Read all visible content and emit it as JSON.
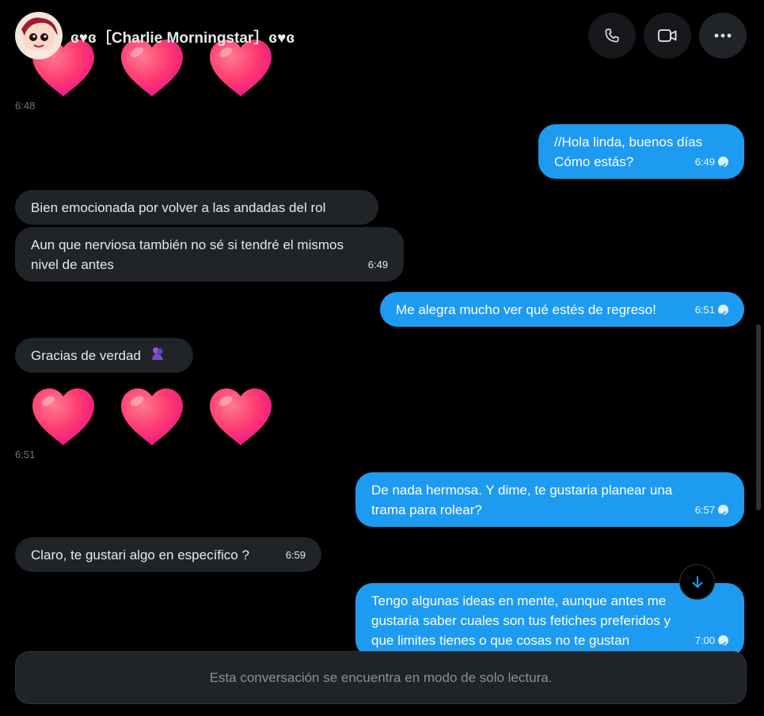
{
  "header": {
    "contact_name": "ɞ♥ɞ［Charlie Morningstar］ɞ♥ɞ",
    "call_icon": "phone-icon",
    "video_icon": "video-camera-icon",
    "more_icon": "more-horizontal-icon"
  },
  "colors": {
    "background": "#000000",
    "incoming_bubble": "#202327",
    "outgoing_bubble": "#1d9bf0",
    "heart": "#ff3b70"
  },
  "messages": [
    {
      "id": "m1",
      "direction": "in",
      "kind": "hearts",
      "count": 3,
      "time": "6:48"
    },
    {
      "id": "m2",
      "direction": "out",
      "lines": [
        "//Hola linda, buenos días",
        "Cómo estás?"
      ],
      "time": "6:49"
    },
    {
      "id": "m3",
      "direction": "in",
      "lines": [
        "Bien emocionada por volver a las andadas del rol"
      ],
      "time": ""
    },
    {
      "id": "m4",
      "direction": "in",
      "lines": [
        "Aun que nerviosa también no sé si tendré el mismos",
        "nivel de antes"
      ],
      "time": "6:49"
    },
    {
      "id": "m5",
      "direction": "out",
      "lines": [
        "Me alegra mucho ver qué estés de regreso!"
      ],
      "time": "6:51"
    },
    {
      "id": "m6",
      "direction": "in",
      "lines": [
        "Gracias de verdad"
      ],
      "emoji": "🫂",
      "time": ""
    },
    {
      "id": "m7",
      "direction": "in",
      "kind": "hearts",
      "count": 3,
      "time": "6:51"
    },
    {
      "id": "m8",
      "direction": "out",
      "lines": [
        "De nada hermosa. Y dime, te gustaria planear una",
        "trama para rolear?"
      ],
      "time": "6:57"
    },
    {
      "id": "m9",
      "direction": "in",
      "lines": [
        "Claro, te gustari algo en específico ?"
      ],
      "time": "6:59"
    },
    {
      "id": "m10",
      "direction": "out",
      "lines": [
        "Tengo algunas ideas en mente, aunque antes me",
        "gustaria saber cuales son tus fetiches preferidos y",
        "que limites tienes o que cosas no te gustan"
      ],
      "time": "7:00"
    }
  ],
  "scroll_down_icon": "arrow-down-icon",
  "composer": {
    "read_only_text": "Esta conversación se encuentra en modo de solo lectura."
  }
}
